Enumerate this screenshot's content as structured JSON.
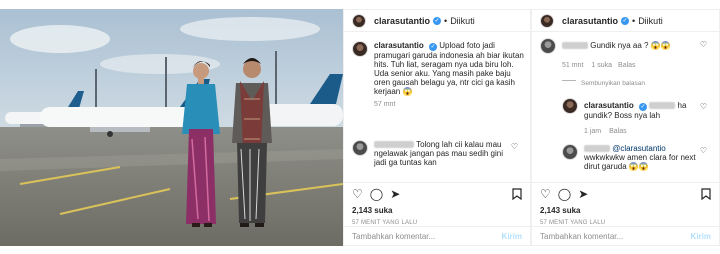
{
  "post": {
    "username": "clarasutantio",
    "follow_label": "Diikuti",
    "dot": "•",
    "verified_glyph": "✓"
  },
  "panel_a": {
    "caption_user": "clarasutantio",
    "caption_text": "Upload foto jadi pramugari garuda indonesia ah biar ikutan hits. Tuh liat, seragam nya uda biru loh. Uda senior aku. Yang masih pake baju oren gausah belagu ya, ntr cici ga kasih kerjaan 😱",
    "caption_time": "57 mnt",
    "comment_text": "Tolong lah cii kalau mau ngelawak jangan pas mau sedih gini jadi ga tuntas kan",
    "likes": "2,143 suka",
    "timestamp": "57 MENIT YANG LALU",
    "composer_placeholder": "Tambahkan komentar...",
    "post_label": "Kirim"
  },
  "panel_b": {
    "c1_text": "Gundik nya aa ? 😱😱",
    "c1_time": "51 mnt",
    "c1_likes": "1 suka",
    "c1_reply": "Balas",
    "hide_replies": "Sembunyikan balasan",
    "c2_user": "clarasutantio",
    "c2_text": "ha gundik? Boss nya lah",
    "c2_time": "1 jam",
    "c2_reply": "Balas",
    "c3_mention": "@clarasutantio",
    "c3_text": "wwkwkwkw amen clara for next dirut garuda 😱😱",
    "likes": "2,143 suka",
    "timestamp": "57 MENIT YANG LALU",
    "composer_placeholder": "Tambahkan komentar...",
    "post_label": "Kirim"
  },
  "icons": {
    "heart": "♡",
    "comment": "◯",
    "share": "➤",
    "bookmark": "🔖"
  },
  "colors": {
    "verified_blue": "#3897f0",
    "muted_text": "#8e8e8e",
    "post_button": "#b2dffc"
  }
}
